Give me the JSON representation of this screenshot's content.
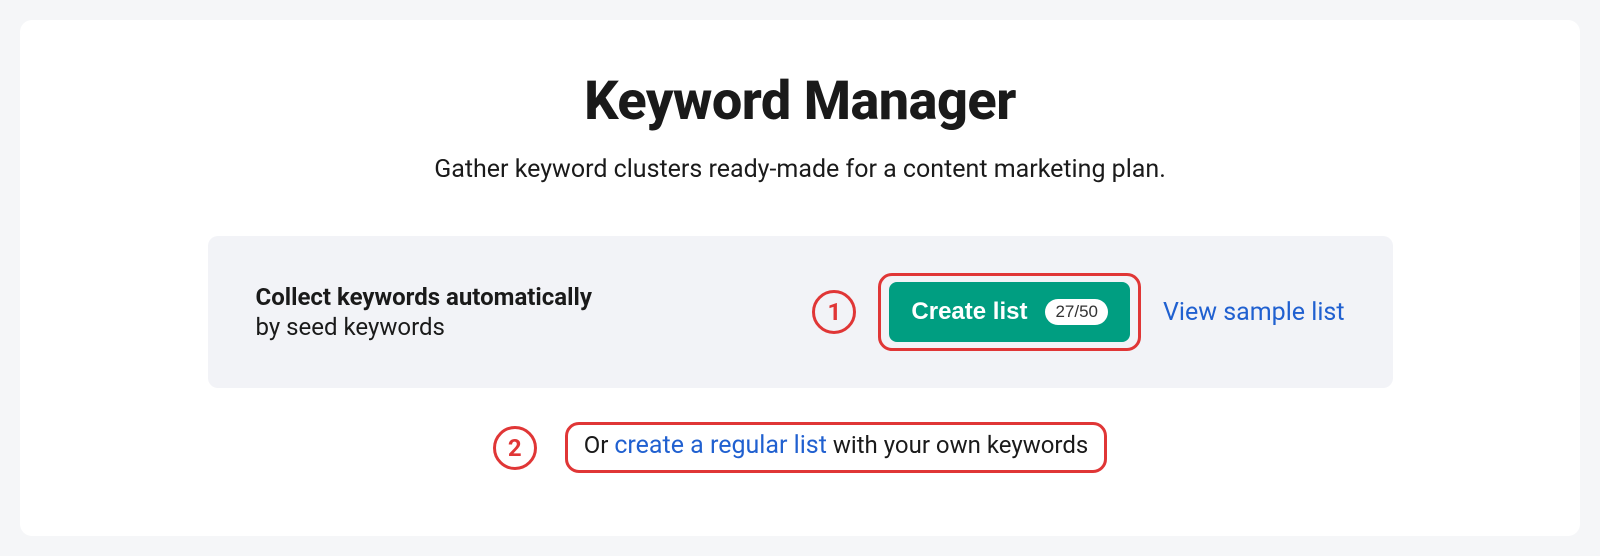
{
  "page": {
    "title": "Keyword Manager",
    "subtitle": "Gather keyword clusters ready-made for a content marketing plan."
  },
  "panel": {
    "heading": "Collect keywords automatically",
    "subheading": "by seed keywords",
    "create_button_label": "Create list",
    "create_button_count": "27/50",
    "sample_link_label": "View sample list"
  },
  "annotations": {
    "marker1": "1",
    "marker2": "2"
  },
  "footer": {
    "prefix": "Or ",
    "link_label": "create a regular list",
    "suffix": " with your own keywords"
  }
}
